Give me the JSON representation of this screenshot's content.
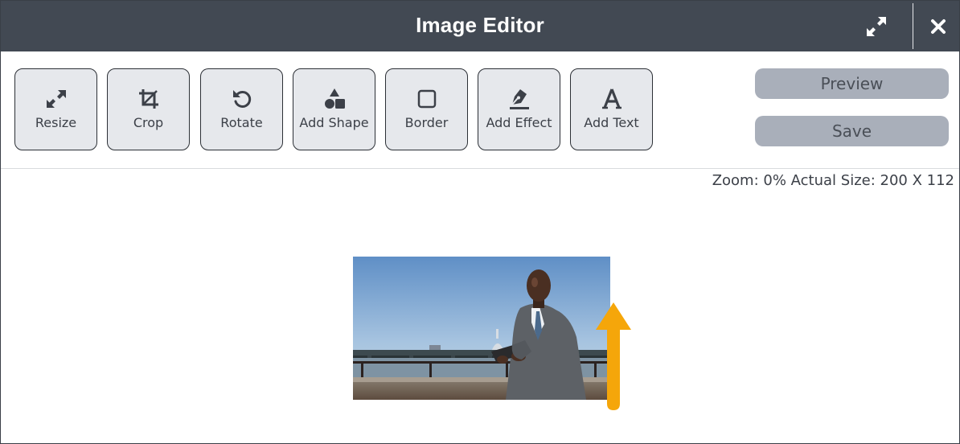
{
  "window": {
    "title": "Image Editor",
    "expand_icon": "expand-arrows-icon",
    "close_icon": "close-x-icon"
  },
  "toolbar": {
    "tools": [
      {
        "label": "Resize",
        "icon": "resize-arrows-icon"
      },
      {
        "label": "Crop",
        "icon": "crop-icon"
      },
      {
        "label": "Rotate",
        "icon": "rotate-ccw-icon"
      },
      {
        "label": "Add Shape",
        "icon": "shapes-icon"
      },
      {
        "label": "Border",
        "icon": "square-outline-icon"
      },
      {
        "label": "Add Effect",
        "icon": "pen-nib-icon"
      },
      {
        "label": "Add Text",
        "icon": "letter-a-icon"
      }
    ],
    "preview_label": "Preview",
    "save_label": "Save"
  },
  "canvas": {
    "zoom_text": "Zoom: 0% Actual Size: 200 X 112",
    "image_subject": "man-in-suit-holding-tablet-by-river"
  },
  "annotation": {
    "arrow_color": "#f5a60a",
    "points_to": "Add Text"
  },
  "colors": {
    "titlebar": "#424953",
    "tool_bg": "#e6e8ec",
    "side_button_bg": "#a9afba"
  }
}
